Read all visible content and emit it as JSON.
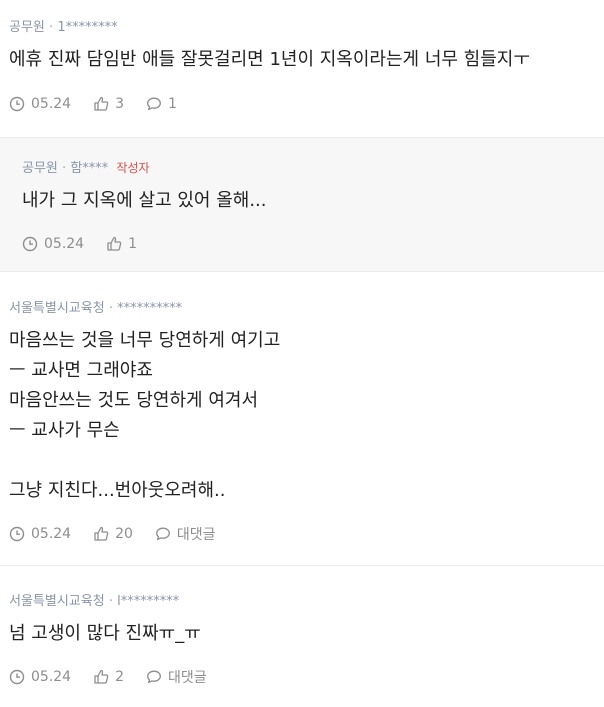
{
  "comments": [
    {
      "org": "공무원",
      "user": "1********",
      "is_author": false,
      "author_label": "",
      "text": "에휴 진짜 담임반 애들 잘못걸리면 1년이 지옥이라는게 너무 힘들지ㅜ",
      "date": "05.24",
      "likes": "3",
      "replies": "1"
    },
    {
      "org": "공무원",
      "user": "함****",
      "is_author": true,
      "author_label": "작성자",
      "text": "내가 그 지옥에 살고 있어 올해...",
      "date": "05.24",
      "likes": "1",
      "replies": ""
    },
    {
      "org": "서울특별시교육청",
      "user": "**********",
      "is_author": false,
      "author_label": "",
      "text": "마음쓰는 것을 너무 당연하게 여기고\nㅡ 교사면 그래야죠\n마음안쓰는 것도 당연하게 여겨서\nㅡ 교사가 무슨\n\n그냥 지친다...번아웃오려해..",
      "date": "05.24",
      "likes": "20",
      "replies": "대댓글"
    },
    {
      "org": "서울특별시교육청",
      "user": "l*********",
      "is_author": false,
      "author_label": "",
      "text": "넘 고생이 많다 진짜ㅠ_ㅠ",
      "date": "05.24",
      "likes": "2",
      "replies": "대댓글"
    }
  ],
  "separator": "·"
}
